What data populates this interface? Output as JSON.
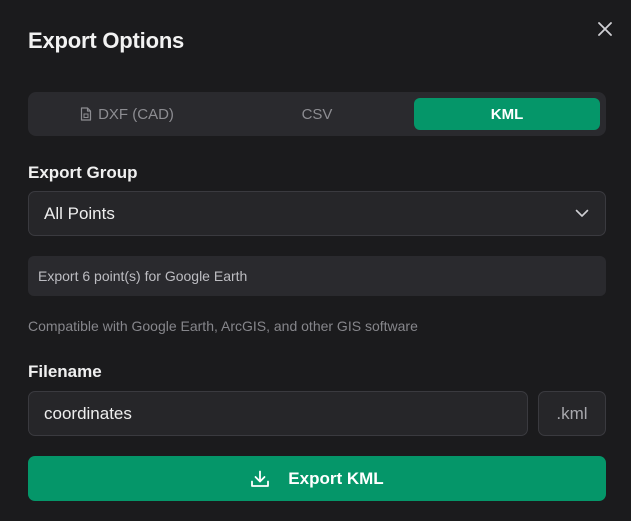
{
  "dialog": {
    "title": "Export Options",
    "close_icon": "close-icon"
  },
  "tabs": [
    {
      "label": "DXF (CAD)",
      "icon": "file-icon",
      "active": false
    },
    {
      "label": "CSV",
      "active": false
    },
    {
      "label": "KML",
      "active": true
    }
  ],
  "export_group": {
    "label": "Export Group",
    "selected": "All Points",
    "icon": "chevron-down-icon"
  },
  "info": {
    "text": "Export 6 point(s) for Google Earth"
  },
  "helper": {
    "text": "Compatible with Google Earth, ArcGIS, and other GIS software"
  },
  "filename": {
    "label": "Filename",
    "value": "coordinates",
    "extension": ".kml"
  },
  "export_button": {
    "label": "Export KML",
    "icon": "download-icon"
  },
  "colors": {
    "accent": "#059669",
    "background": "#1b1b1d",
    "surface": "#2a2a2e"
  }
}
